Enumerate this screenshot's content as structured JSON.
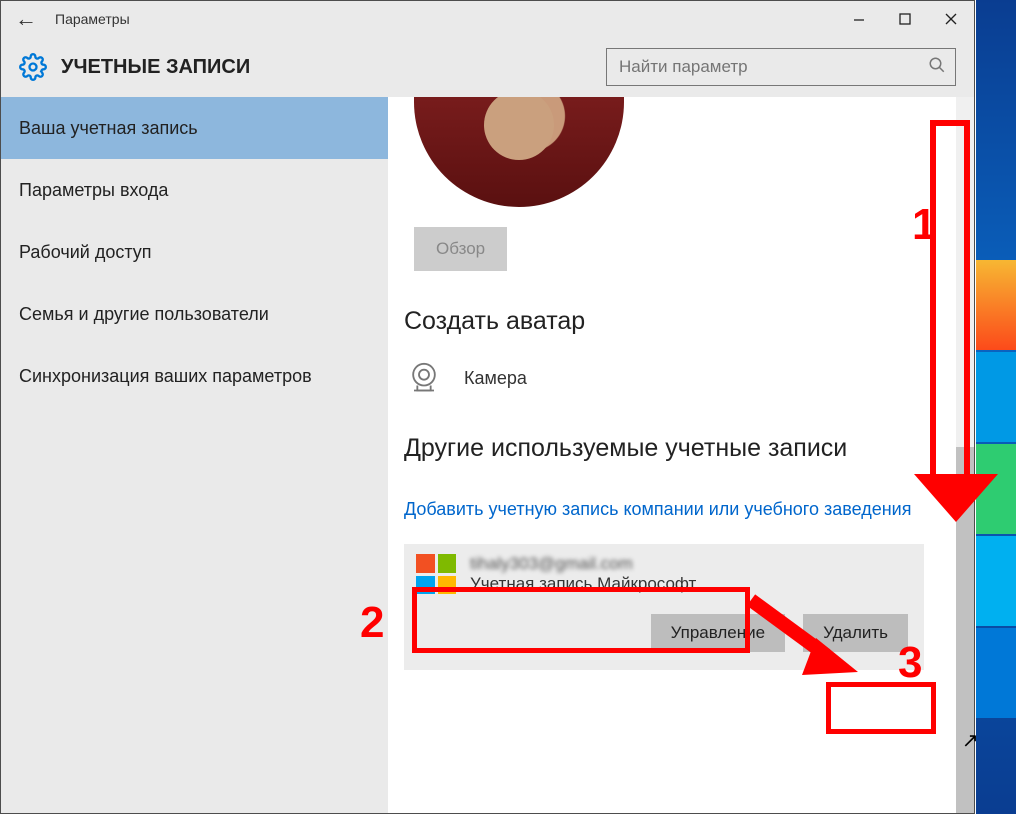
{
  "titlebar": {
    "title": "Параметры"
  },
  "header": {
    "page_title": "УЧЕТНЫЕ ЗАПИСИ",
    "search_placeholder": "Найти параметр"
  },
  "sidebar": {
    "items": [
      {
        "label": "Ваша учетная запись",
        "active": true
      },
      {
        "label": "Параметры входа",
        "active": false
      },
      {
        "label": "Рабочий доступ",
        "active": false
      },
      {
        "label": "Семья и другие пользователи",
        "active": false
      },
      {
        "label": "Синхронизация ваших параметров",
        "active": false
      }
    ]
  },
  "content": {
    "browse_label": "Обзор",
    "create_avatar_heading": "Создать аватар",
    "camera_label": "Камера",
    "other_accounts_heading": "Другие используемые учетные записи",
    "add_account_link": "Добавить учетную запись компании или учебного заведения",
    "account": {
      "email_obscured": "tihaly303@gmail.com",
      "type_label": "Учетная запись Майкрософт"
    },
    "manage_label": "Управление",
    "delete_label": "Удалить"
  },
  "annotations": {
    "n1": "1",
    "n2": "2",
    "n3": "3"
  }
}
